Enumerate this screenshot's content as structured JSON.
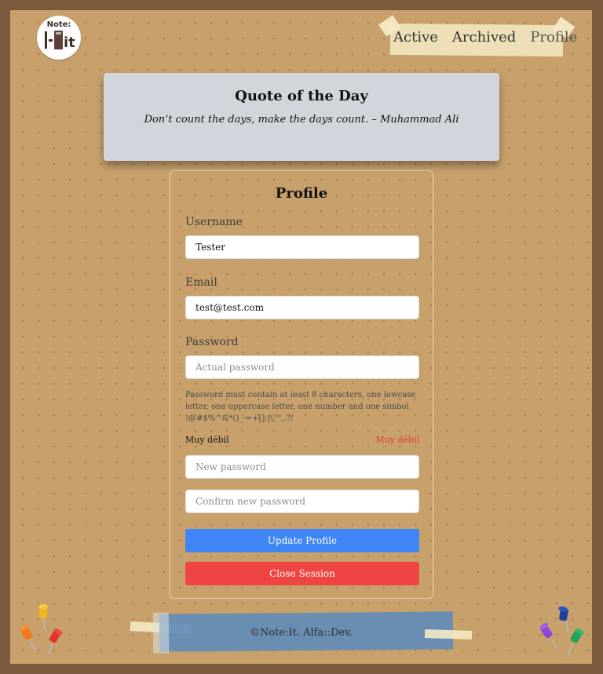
{
  "logo": {
    "top_text": "Note:",
    "mark_text": "|-▮it"
  },
  "nav": {
    "items": [
      "Active",
      "Archived",
      "Profile"
    ]
  },
  "quote": {
    "title": "Quote of the Day",
    "text": "Don’t count the days, make the days count. – Muhammad Ali"
  },
  "profile": {
    "title": "Profile",
    "username": {
      "label": "Username",
      "value": "Tester"
    },
    "email": {
      "label": "Email",
      "value": "test@test.com"
    },
    "password": {
      "label": "Password",
      "placeholder": "Actual password"
    },
    "hint": "Password must contain at least 8 characters, one lowcase letter, one uppercase letter, one number and one simbol !@#$%^&*()_-=+[]:|\\;\"',.?/",
    "strength_left": "Muy débil",
    "strength_right": "Muy débil",
    "new_password": {
      "placeholder": "New password"
    },
    "confirm_password": {
      "placeholder": "Confirm new password"
    },
    "update_button": "Update Profile",
    "close_button": "Close Session"
  },
  "footer": {
    "text": "©Note:It. Alfa::Dev."
  },
  "colors": {
    "frame": "#7a5a3c",
    "board": "#c7a06b",
    "quote_card": "#d1d5dc",
    "primary": "#3f85f5",
    "danger": "#ef4444",
    "footer_tape": "#5f8cb9"
  },
  "icons": [
    "logo-icon",
    "pushpin-icon"
  ]
}
